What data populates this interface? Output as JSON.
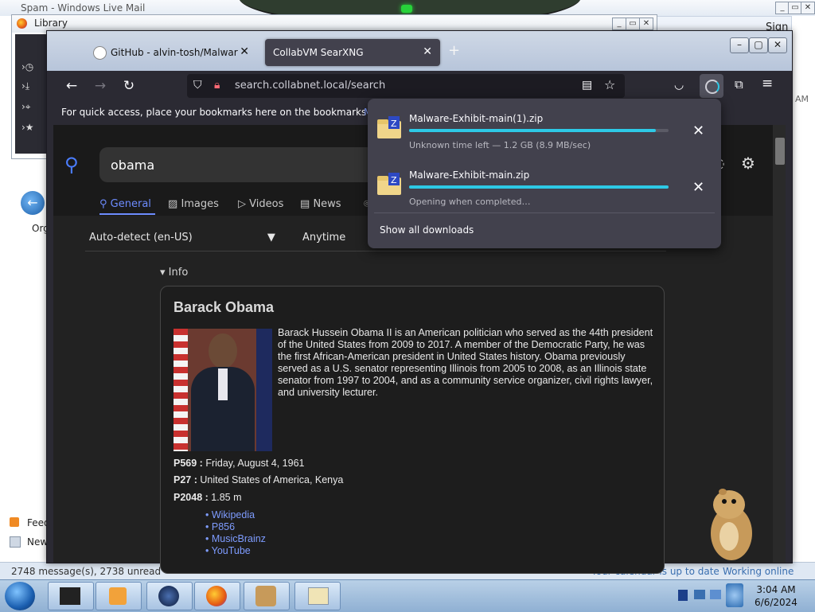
{
  "background_window": {
    "title": "Spam - Windows Live Mail",
    "sign_in": "Sign in",
    "status_left": "2748 message(s), 2738 unread",
    "status_calendar": "Your calendar is up to date",
    "status_online": "Working online",
    "side_items": [
      "Org",
      "Feed",
      "New"
    ],
    "right_edge_text": "AM"
  },
  "library_window": {
    "title": "Library"
  },
  "browser": {
    "tabs": [
      {
        "label": "GitHub - alvin-tosh/Malware-E",
        "active": false
      },
      {
        "label": "CollabVM SearXNG",
        "active": true
      }
    ],
    "url": "search.collabnet.local/search",
    "bookmarks_hint": "For quick access, place your bookmarks here on the bookmarks toolbar.",
    "bookmarks_link_char": "M"
  },
  "search_page": {
    "query": "obama",
    "categories": [
      "General",
      "Images",
      "Videos",
      "News"
    ],
    "active_category": "General",
    "language": "Auto-detect (en-US)",
    "time_range": "Anytime",
    "info_heading": "Info",
    "infobox": {
      "title": "Barack Obama",
      "description": "Barack Hussein Obama II is an American politician who served as the 44th president of the United States from 2009 to 2017. A member of the Democratic Party, he was the first African-American president in United States history. Obama previously served as a U.S. senator representing Illinois from 2005 to 2008, as an Illinois state senator from 1997 to 2004, and as a community service organizer, civil rights lawyer, and university lecturer.",
      "properties": [
        {
          "key": "P569 :",
          "value": "Friday, August 4, 1961"
        },
        {
          "key": "P27 :",
          "value": "United States of America, Kenya"
        },
        {
          "key": "P2048 :",
          "value": "1.85 m"
        }
      ],
      "links": [
        "Wikipedia",
        "P856",
        "MusicBrainz",
        "YouTube"
      ]
    }
  },
  "downloads": {
    "items": [
      {
        "name": "Malware-Exhibit-main(1).zip",
        "status": "Unknown time left — 1.2 GB (8.9 MB/sec)",
        "progress": 0.95
      },
      {
        "name": "Malware-Exhibit-main.zip",
        "status": "Opening when completed…",
        "progress": 1.0
      }
    ],
    "show_all": "Show all downloads"
  },
  "taskbar": {
    "time": "3:04 AM",
    "date": "6/6/2024"
  },
  "colors": {
    "accent": "#2dc9e6",
    "link": "#7e9cff",
    "search_icon": "#4b7dff",
    "firefox_toolbar": "#2b2a33"
  }
}
